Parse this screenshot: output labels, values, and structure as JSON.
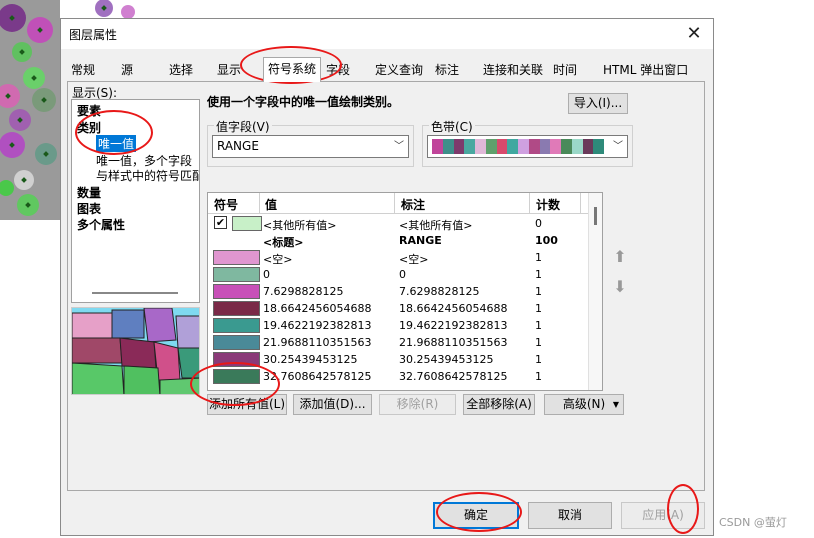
{
  "dialog": {
    "title": "图层属性",
    "tabs": [
      "常规",
      "源",
      "选择",
      "显示",
      "符号系统",
      "字段",
      "定义查询",
      "标注",
      "连接和关联",
      "时间",
      "HTML 弹出窗口"
    ],
    "active_tab": "符号系统"
  },
  "show": {
    "label": "显示(S):",
    "items": {
      "features": "要素",
      "categories": "类别",
      "unique_value": "唯一值",
      "unique_many": "唯一值，多个字段",
      "match_style": "与样式中的符号匹配",
      "quantities": "数量",
      "charts": "图表",
      "multi": "多个属性"
    }
  },
  "main": {
    "heading": "使用一个字段中的唯一值绘制类别。",
    "import_button": "导入(I)...",
    "value_field": {
      "label": "值字段(V)",
      "value": "RANGE"
    },
    "color_ramp": {
      "label": "色带(C)",
      "colors": [
        "#c0449a",
        "#3e8f8a",
        "#7e3a6c",
        "#4aa8a0",
        "#e0b8d8",
        "#5fa06c",
        "#d84a6c",
        "#40a8a0",
        "#cfa0e0",
        "#b04a86",
        "#8a7ab0",
        "#e07ab8",
        "#4a8a5a",
        "#9ad8c8",
        "#6a3a5a",
        "#2e8a7a"
      ]
    },
    "table": {
      "headers": {
        "symbol": "符号",
        "value": "值",
        "label": "标注",
        "count": "计数"
      },
      "rows": [
        {
          "value": "<其他所有值>",
          "label": "<其他所有值>",
          "count": "0",
          "color": "#c8f0c8",
          "checked": true
        },
        {
          "value": "<标题>",
          "label": "RANGE",
          "count": "100",
          "bold": true
        },
        {
          "value": "<空>",
          "label": "<空>",
          "count": "1",
          "color": "#e096d0"
        },
        {
          "value": "0",
          "label": "0",
          "count": "1",
          "color": "#7fb8a0"
        },
        {
          "value": "7.6298828125",
          "label": "7.6298828125",
          "count": "1",
          "color": "#c850b8"
        },
        {
          "value": "18.6642456054688",
          "label": "18.6642456054688",
          "count": "1",
          "color": "#7a2a48"
        },
        {
          "value": "19.4622192382813",
          "label": "19.4622192382813",
          "count": "1",
          "color": "#3a9a90"
        },
        {
          "value": "21.9688110351563",
          "label": "21.9688110351563",
          "count": "1",
          "color": "#4a8a98"
        },
        {
          "value": "30.25439453125",
          "label": "30.25439453125",
          "count": "1",
          "color": "#8a3a78"
        },
        {
          "value": "32.7608642578125",
          "label": "32.7608642578125",
          "count": "1",
          "color": "#3a7a5a"
        }
      ]
    },
    "buttons": {
      "add_all": "添加所有值(L)",
      "add": "添加值(D)...",
      "remove": "移除(R)",
      "remove_all": "全部移除(A)",
      "advanced": "高级(N)"
    }
  },
  "footer": {
    "ok": "确定",
    "cancel": "取消",
    "apply": "应用(A)"
  },
  "watermark": "CSDN @萤灯"
}
